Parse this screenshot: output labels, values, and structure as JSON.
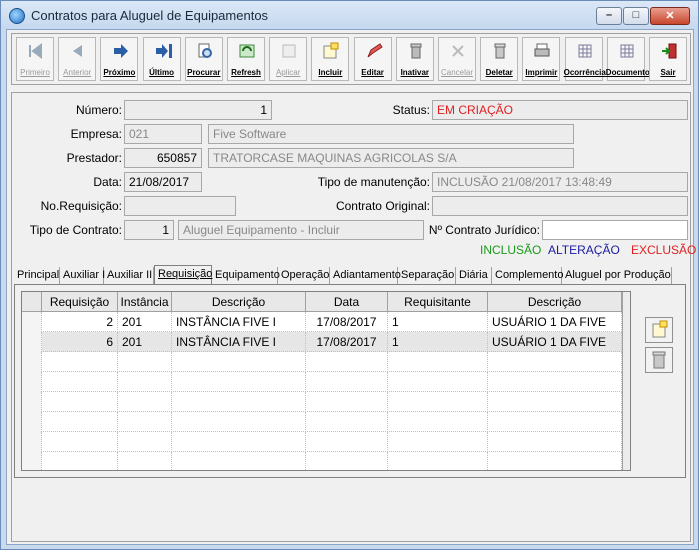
{
  "window": {
    "title": "Contratos para Aluguel de Equipamentos",
    "min": "–",
    "max": "□",
    "close": "✕"
  },
  "toolbar": [
    {
      "label": "Primeiro",
      "icon": "first-record-icon",
      "disabled": true
    },
    {
      "label": "Anterior",
      "icon": "previous-record-icon",
      "disabled": true
    },
    {
      "label": "Próximo",
      "icon": "next-record-icon",
      "disabled": false
    },
    {
      "label": "Último",
      "icon": "last-record-icon",
      "disabled": false
    },
    {
      "label": "Procurar",
      "icon": "search-icon",
      "disabled": false
    },
    {
      "label": "Refresh",
      "icon": "refresh-icon",
      "disabled": false
    },
    {
      "label": "Aplicar",
      "icon": "apply-icon",
      "disabled": true
    },
    {
      "label": "Incluir",
      "icon": "new-record-icon",
      "disabled": false
    },
    {
      "label": "Editar",
      "icon": "edit-icon",
      "disabled": false
    },
    {
      "label": "Inativar",
      "icon": "inactivate-icon",
      "disabled": false
    },
    {
      "label": "Cancelar",
      "icon": "cancel-icon",
      "disabled": true
    },
    {
      "label": "Deletar",
      "icon": "trash-icon",
      "disabled": false
    },
    {
      "label": "Imprimir",
      "icon": "printer-icon",
      "disabled": false
    },
    {
      "label": "Ocorrência",
      "icon": "occurrence-grid-icon",
      "disabled": false
    },
    {
      "label": "Documento",
      "icon": "document-grid-icon",
      "disabled": false
    },
    {
      "label": "Sair",
      "icon": "exit-door-icon",
      "disabled": false
    }
  ],
  "form": {
    "numero_label": "Número:",
    "numero": "1",
    "status_label": "Status:",
    "status": "EM CRIAÇÃO",
    "empresa_label": "Empresa:",
    "empresa_codigo": "021",
    "empresa_nome": "Five Software",
    "prestador_label": "Prestador:",
    "prestador_codigo": "650857",
    "prestador_nome": "TRATORCASE MAQUINAS AGRICOLAS S/A",
    "data_label": "Data:",
    "data": "21/08/2017",
    "tipo_manut_label": "Tipo de manutenção:",
    "tipo_manut": "INCLUSÃO 21/08/2017 13:48:49",
    "requisicao_label": "No.Requisição:",
    "requisicao": "",
    "contrato_original_label": "Contrato Original:",
    "contrato_original": "",
    "tipo_contrato_label": "Tipo de Contrato:",
    "tipo_contrato_codigo": "1",
    "tipo_contrato_nome": "Aluguel Equipamento - Incluir",
    "contrato_juridico_label": "Nº Contrato Jurídico:",
    "contrato_juridico": ""
  },
  "legend": {
    "inclusao": "INCLUSÃO",
    "alteracao": "ALTERAÇÃO",
    "exclusao": "EXCLUSÃO",
    "colors": {
      "inclusao": "#1a9a1a",
      "alteracao": "#1a1aa0",
      "exclusao": "#e02020"
    }
  },
  "tabs": [
    "Principal",
    "Auxiliar I",
    "Auxiliar II",
    "Requisição",
    "Equipamento",
    "Operação",
    "Adiantamento",
    "Separação",
    "Diária",
    "Complemento",
    "Aluguel por Produção"
  ],
  "grid": {
    "headers": [
      "Requisição",
      "Instância",
      "Descrição",
      "Data",
      "Requisitante",
      "Descrição"
    ],
    "rows": [
      [
        "2",
        "201",
        "INSTÂNCIA FIVE I",
        "17/08/2017",
        "1",
        "USUÁRIO 1 DA FIVE"
      ],
      [
        "6",
        "201",
        "INSTÂNCIA FIVE I",
        "17/08/2017",
        "1",
        "USUÁRIO 1 DA FIVE"
      ]
    ]
  },
  "side_buttons": [
    {
      "icon": "add-record-icon"
    },
    {
      "icon": "trash-icon"
    }
  ]
}
